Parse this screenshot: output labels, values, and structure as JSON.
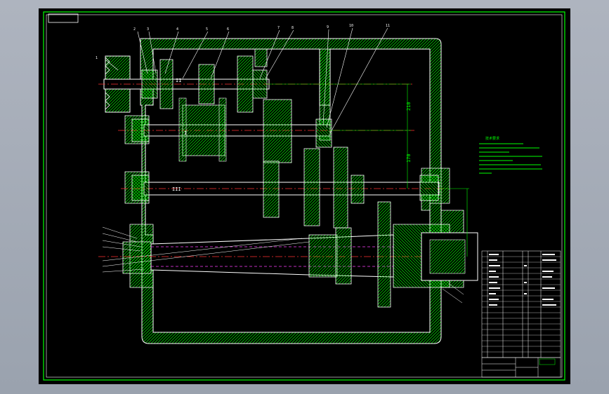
{
  "viewer": {
    "background_color": "#a4abb6",
    "canvas_color": "#000000"
  },
  "drawing": {
    "colors": {
      "frame": "#00ff00",
      "outline": "#ffffff",
      "hatch": "#00ff00",
      "centerline": "#ff3030",
      "hidden": "#ff40ff",
      "dimension": "#00ff00",
      "leader": "#ffffff"
    },
    "part_callouts": [
      "1",
      "2",
      "3",
      "4",
      "5",
      "6",
      "7",
      "8",
      "9",
      "10",
      "11"
    ],
    "shaft_labels": [
      "I",
      "II",
      "III"
    ],
    "dimensions": [
      "210",
      "170"
    ],
    "notes_title": "技术要求"
  }
}
